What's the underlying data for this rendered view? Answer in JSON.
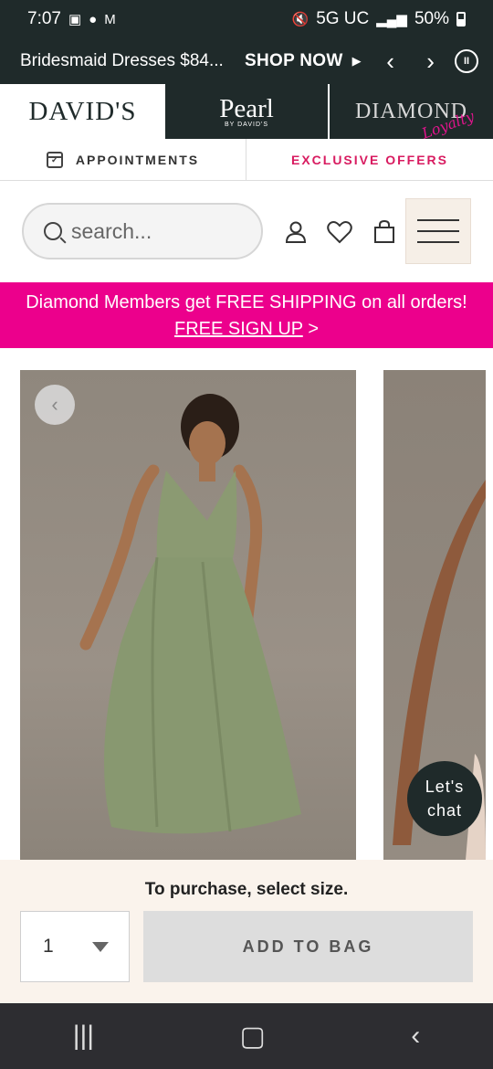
{
  "status_bar": {
    "time": "7:07",
    "network": "5G UC",
    "battery": "50%"
  },
  "promo": {
    "text": "Bridesmaid Dresses $84...",
    "cta": "SHOP NOW"
  },
  "brands": {
    "davids": "DAVID'S",
    "pearl": "Pearl",
    "pearl_sub": "BY DAVID'S",
    "diamond": "DIAMOND",
    "diamond_script": "Loyalty"
  },
  "top_links": {
    "appointments": "APPOINTMENTS",
    "offers": "EXCLUSIVE OFFERS"
  },
  "search": {
    "placeholder": "search..."
  },
  "banner": {
    "line1": "Diamond Members get FREE SHIPPING on all orders!",
    "link": "FREE SIGN UP",
    "link_suffix": " >"
  },
  "chat": {
    "line1": "Let's",
    "line2": "chat"
  },
  "purchase": {
    "message": "To purchase, select size.",
    "quantity": "1",
    "add_to_bag": "ADD TO BAG"
  },
  "colors": {
    "dark": "#1f2a2a",
    "pink": "#ec008c",
    "offers_red": "#d81b60",
    "cream": "#faf3ec",
    "dress_green": "#8b9a72"
  }
}
